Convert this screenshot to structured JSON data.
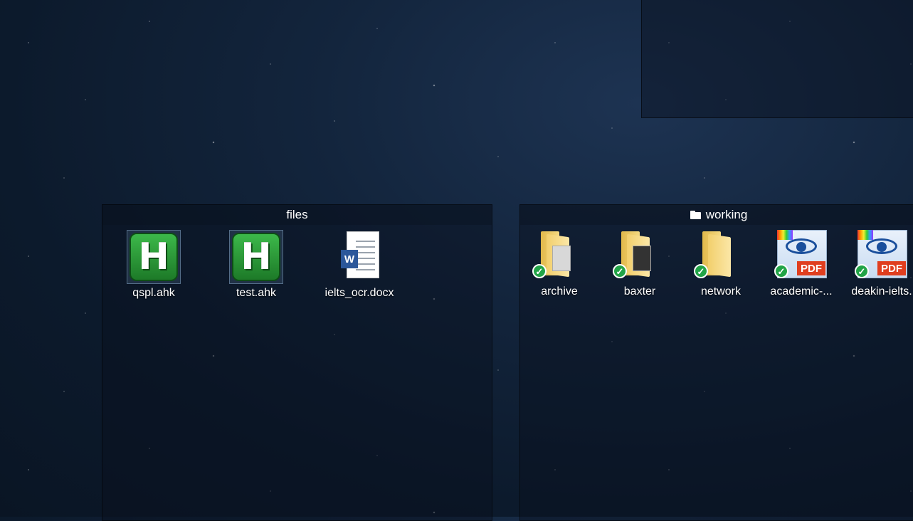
{
  "desktop": {
    "background": "starry-night-wallpaper"
  },
  "fences": [
    {
      "title": "files",
      "items": [
        {
          "label": "qspl.ahk",
          "icon": "autohotkey-icon"
        },
        {
          "label": "test.ahk",
          "icon": "autohotkey-icon"
        },
        {
          "label": "ielts_ocr.docx",
          "icon": "word-document-icon",
          "badge": "W"
        }
      ]
    },
    {
      "title": "working",
      "title_icon": "folder-icon",
      "items": [
        {
          "label": "archive",
          "icon": "folder-icon",
          "status": "synced-check-icon"
        },
        {
          "label": "baxter",
          "icon": "folder-icon",
          "status": "synced-check-icon"
        },
        {
          "label": "network",
          "icon": "folder-icon",
          "status": "synced-check-icon"
        },
        {
          "label": "academic-...",
          "icon": "pdf-icon",
          "badge": "PDF",
          "status": "synced-check-icon"
        },
        {
          "label": "deakin-ielts.",
          "icon": "pdf-icon",
          "badge": "PDF",
          "status": "synced-check-icon"
        }
      ]
    }
  ],
  "colors": {
    "accent_check": "#22a447",
    "pdf_tag": "#e03e1f",
    "word_blue": "#2b579a",
    "ahk_green": "#2e9a3b"
  }
}
